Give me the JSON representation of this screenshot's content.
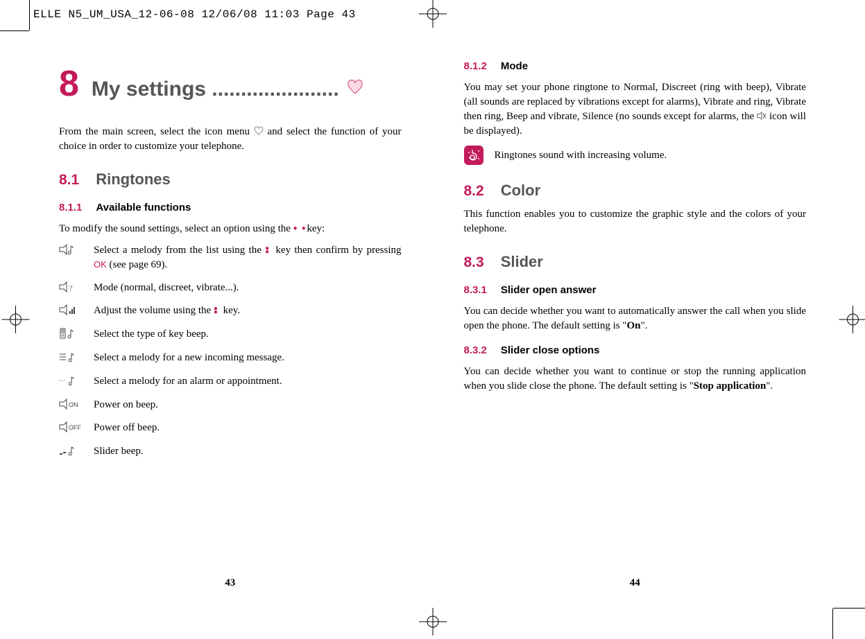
{
  "header": "ELLE N5_UM_USA_12-06-08  12/06/08  11:03  Page 43",
  "left": {
    "chapter_num": "8",
    "chapter_title": "My settings ......................",
    "intro_a": "From the main screen, select the icon menu ",
    "intro_b": " and select the function of your choice in order to customize your telephone.",
    "s81_num": "8.1",
    "s81_title": "Ringtones",
    "s811_num": "8.1.1",
    "s811_title": "Available functions",
    "s811_intro_a": "To modify the sound settings, select an option using the ",
    "s811_intro_b": " key:",
    "funcs": [
      {
        "icon": "melody-icon",
        "text_a": "Select a melody from the list using the ",
        "text_b": " key then confirm by pressing ",
        "ok": "OK",
        "text_c": " (see page 69)."
      },
      {
        "icon": "mode-icon",
        "text": "Mode (normal, discreet, vibrate...)."
      },
      {
        "icon": "volume-icon",
        "text_a": "Adjust the volume using the ",
        "text_b": " key."
      },
      {
        "icon": "keybeep-icon",
        "text": "Select the type of key beep."
      },
      {
        "icon": "msg-melody-icon",
        "text": "Select a melody for a new incoming message."
      },
      {
        "icon": "alarm-melody-icon",
        "text": "Select a melody for an alarm or appointment."
      },
      {
        "icon": "poweron-icon",
        "text": "Power on beep."
      },
      {
        "icon": "poweroff-icon",
        "text": "Power off beep."
      },
      {
        "icon": "slider-beep-icon",
        "text": "Slider beep."
      }
    ],
    "page_num": "43"
  },
  "right": {
    "s812_num": "8.1.2",
    "s812_title": "Mode",
    "s812_text_a": "You may set your phone ringtone to Normal, Discreet (ring with beep), Vibrate (all sounds are replaced by vibrations except for alarms), Vibrate and ring, Vibrate then ring, Beep and vibrate, Silence (no sounds except for alarms, the ",
    "s812_text_b": " icon will be displayed).",
    "ring_tip": "Ringtones sound with increasing volume.",
    "s82_num": "8.2",
    "s82_title": "Color",
    "s82_text": "This function enables you to customize the graphic style and the colors of your telephone.",
    "s83_num": "8.3",
    "s83_title": "Slider",
    "s831_num": "8.3.1",
    "s831_title": "Slider open answer",
    "s831_text_a": "You can decide whether you want to automatically answer the call when you slide open the phone. The default setting is \"",
    "s831_bold": "On",
    "s831_text_b": "\".",
    "s832_num": "8.3.2",
    "s832_title": "Slider close options",
    "s832_text_a": "You can decide whether you want to continue or stop the running application when you slide close the phone. The default setting is \"",
    "s832_bold": "Stop application",
    "s832_text_b": "\".",
    "page_num": "44"
  }
}
